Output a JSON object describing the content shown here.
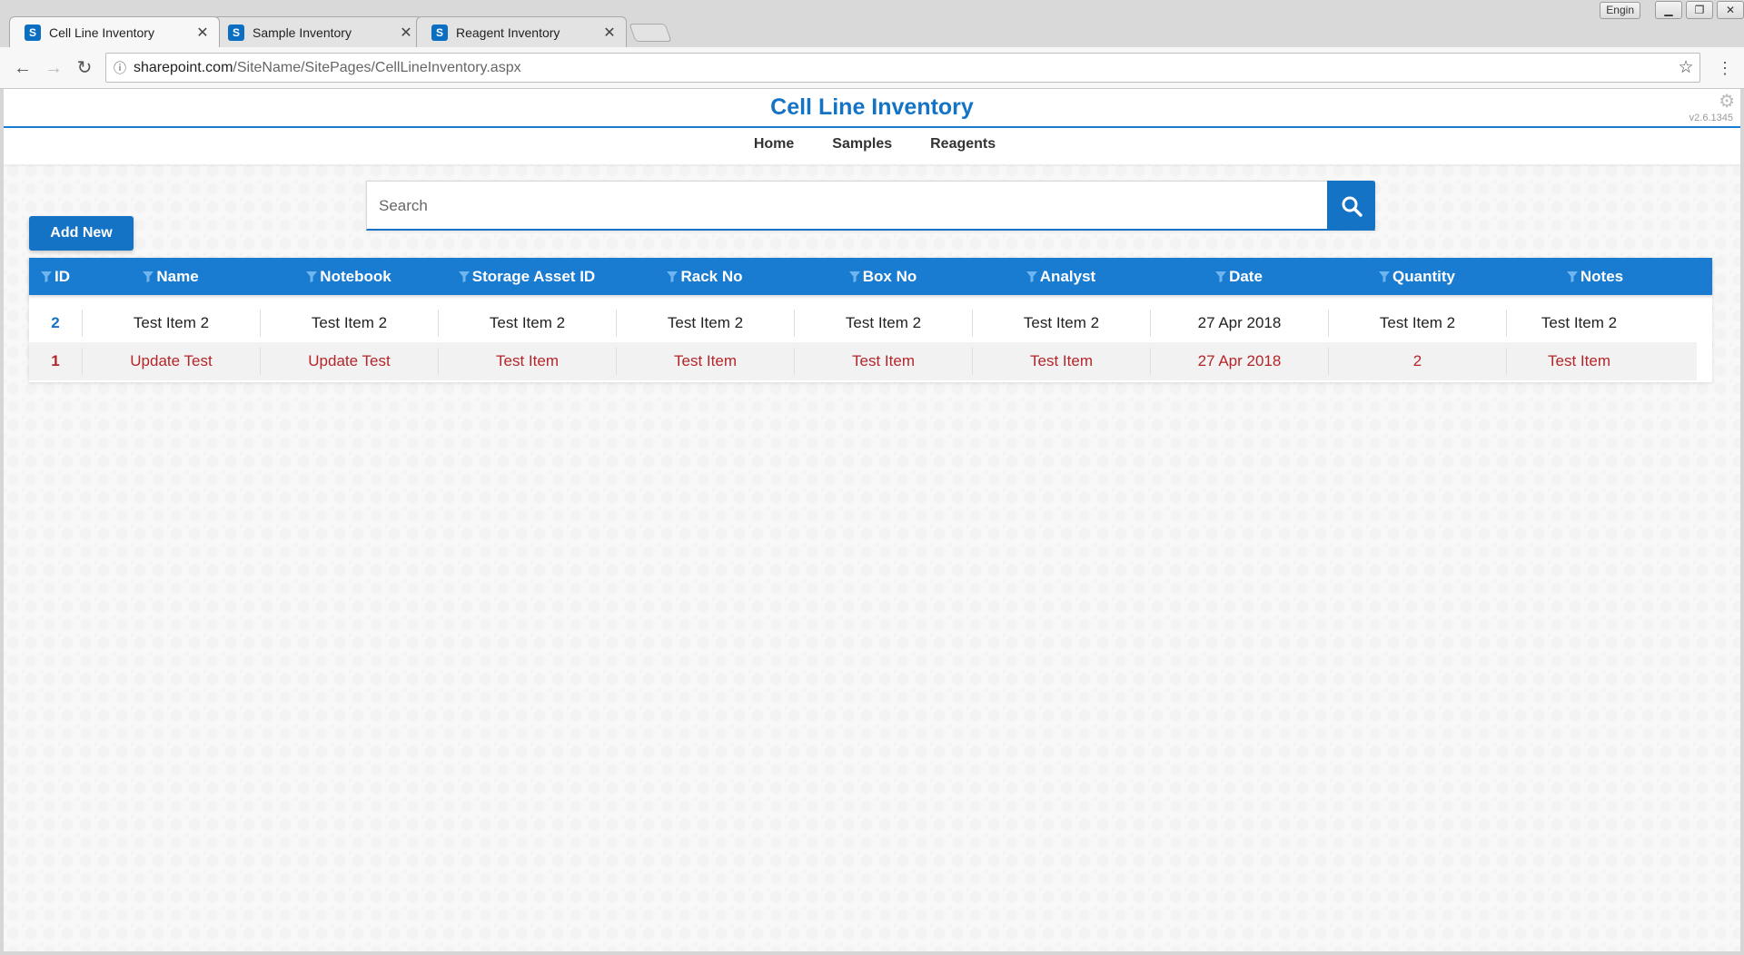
{
  "browser": {
    "user": "Engin",
    "tabs": [
      {
        "title": "Cell Line Inventory",
        "active": true
      },
      {
        "title": "Sample Inventory",
        "active": false
      },
      {
        "title": "Reagent Inventory",
        "active": false
      }
    ],
    "url_host": "sharepoint.com",
    "url_path": "/SiteName/SitePages/CellLineInventory.aspx"
  },
  "app": {
    "title": "Cell Line Inventory",
    "version": "v2.6.1345",
    "nav": [
      "Home",
      "Samples",
      "Reagents"
    ],
    "accent": "#1573c6"
  },
  "search": {
    "placeholder": "Search",
    "value": ""
  },
  "add_new_label": "Add New",
  "table": {
    "columns": [
      "ID",
      "Name",
      "Notebook",
      "Storage Asset ID",
      "Rack No",
      "Box No",
      "Analyst",
      "Date",
      "Quantity",
      "Notes"
    ],
    "rows": [
      {
        "cells": [
          "2",
          "Test Item 2",
          "Test Item 2",
          "Test Item 2",
          "Test Item 2",
          "Test Item 2",
          "Test Item 2",
          "27 Apr 2018",
          "Test Item 2",
          "Test Item 2"
        ],
        "highlight": false
      },
      {
        "cells": [
          "1",
          "Update Test",
          "Update Test",
          "Test Item",
          "Test Item",
          "Test Item",
          "Test Item",
          "27 Apr 2018",
          "2",
          "Test Item"
        ],
        "highlight": true
      }
    ]
  }
}
